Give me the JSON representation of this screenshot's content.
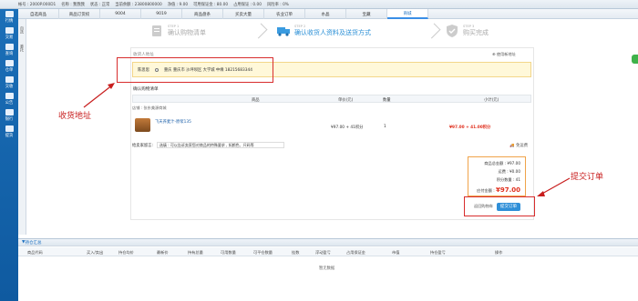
{
  "topbar": {
    "items": [
      "帐号 : 2000P.000D1",
      "名称 : 我我我",
      "状态 : 正常",
      "当前余额 : 23800800000",
      "净值 : 9.00",
      "可用保证金 : 80.00",
      "占用保证 : 0.00",
      "风险率 : 0%"
    ]
  },
  "logo": {
    "text": "▲"
  },
  "sidebar": {
    "items": [
      "行情",
      "交易",
      "查询",
      "仓单",
      "交收",
      "公告",
      "银行",
      "提货"
    ]
  },
  "left_strip": {
    "items": [
      "自选",
      "委托"
    ]
  },
  "tabs": [
    "自选商品",
    "商品订货权",
    "9004",
    "9019",
    "商品盘条",
    "买卖大量",
    "农业订单",
    "水晶",
    "宝藏",
    "商城"
  ],
  "steps": [
    {
      "small": "STEP 1",
      "label": "确认购物清单"
    },
    {
      "small": "STEP 2",
      "label": "确认收货人资料及送货方式"
    },
    {
      "small": "STEP 3",
      "label": "购买完成"
    }
  ],
  "address": {
    "header": "收货人地址",
    "use_new": "使用新地址",
    "name": "陈思思",
    "detail": "重庆 重庆市 沙坪坝区  大学城  中缘   18215683344"
  },
  "confirm": {
    "header": "确认购物清单",
    "columns": {
      "product": "商品",
      "price": "单价(元)",
      "qty": "数量",
      "subtotal": "小计(元)"
    },
    "shop": "店铺 : 张东美源商城",
    "item": {
      "name": "飞天荞麦汁-原浆135",
      "price": "¥97.00 + 41积分",
      "qty": "1",
      "subtotal": "¥97.00 + 41.00积分"
    }
  },
  "message": {
    "label": "给卖家留言:",
    "placeholder": "选填 : 可以告诉卖家您对商品的特殊要求 , 如颜色、尺码等",
    "ship": "免运费"
  },
  "summary": {
    "goods_label": "商品总金额 :",
    "goods": "¥97.00",
    "freight_label": "运费 :",
    "freight": "¥0.00",
    "points_label": "积分数量 : ",
    "points": "41",
    "pay_label": "应付金额 :",
    "pay": "¥97.00"
  },
  "actions": {
    "back": "返回购物车",
    "submit": "提交订单"
  },
  "annotations": {
    "address": "收货地址",
    "submit": "提交订单"
  },
  "bottom": {
    "title": "持仓汇总",
    "columns": [
      "商品代码",
      "买入/卖出",
      "持仓均价",
      "最新价",
      "持有总量",
      "可用数量",
      "可平仓数量",
      "挂数",
      "浮动盈亏",
      "占用保证金",
      "市值",
      "持仓盈亏",
      "操作"
    ],
    "empty": "暂无数据"
  },
  "colors": {
    "accent": "#2f8fd8",
    "highlight": "#fff8d9",
    "price": "#e0301e",
    "annotation": "#c81e1e"
  }
}
